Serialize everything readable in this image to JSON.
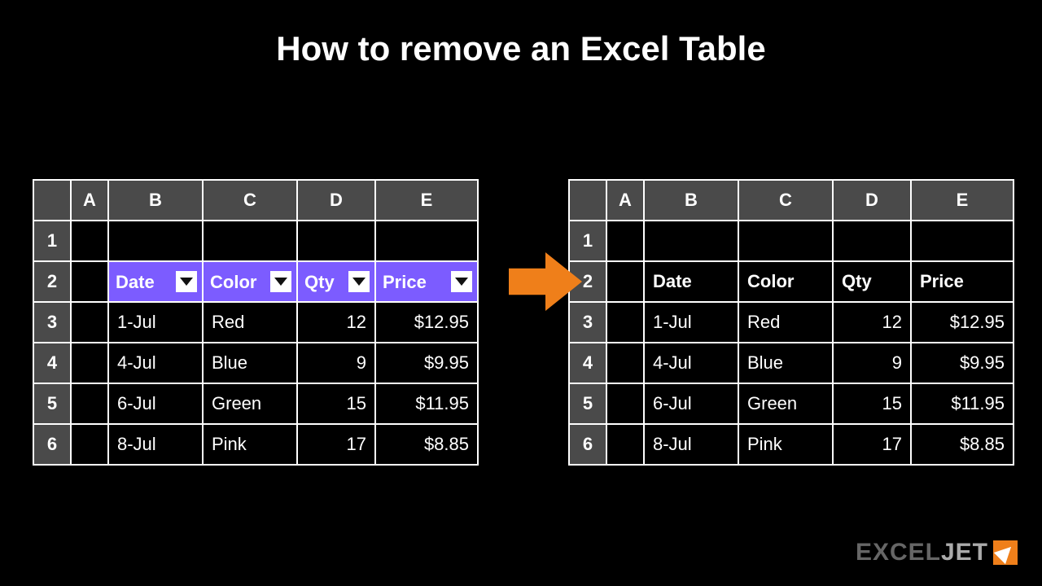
{
  "title": "How to remove an Excel Table",
  "columns": [
    "A",
    "B",
    "C",
    "D",
    "E"
  ],
  "row_numbers": [
    "1",
    "2",
    "3",
    "4",
    "5",
    "6"
  ],
  "headers": [
    "Date",
    "Color",
    "Qty",
    "Price"
  ],
  "rows": [
    {
      "date": "1-Jul",
      "color": "Red",
      "qty": "12",
      "price": "$12.95"
    },
    {
      "date": "4-Jul",
      "color": "Blue",
      "qty": "9",
      "price": "$9.95"
    },
    {
      "date": "6-Jul",
      "color": "Green",
      "qty": "15",
      "price": "$11.95"
    },
    {
      "date": "8-Jul",
      "color": "Pink",
      "qty": "17",
      "price": "$8.85"
    }
  ],
  "logo": {
    "part1": "EXCEL",
    "part2": "JET"
  }
}
